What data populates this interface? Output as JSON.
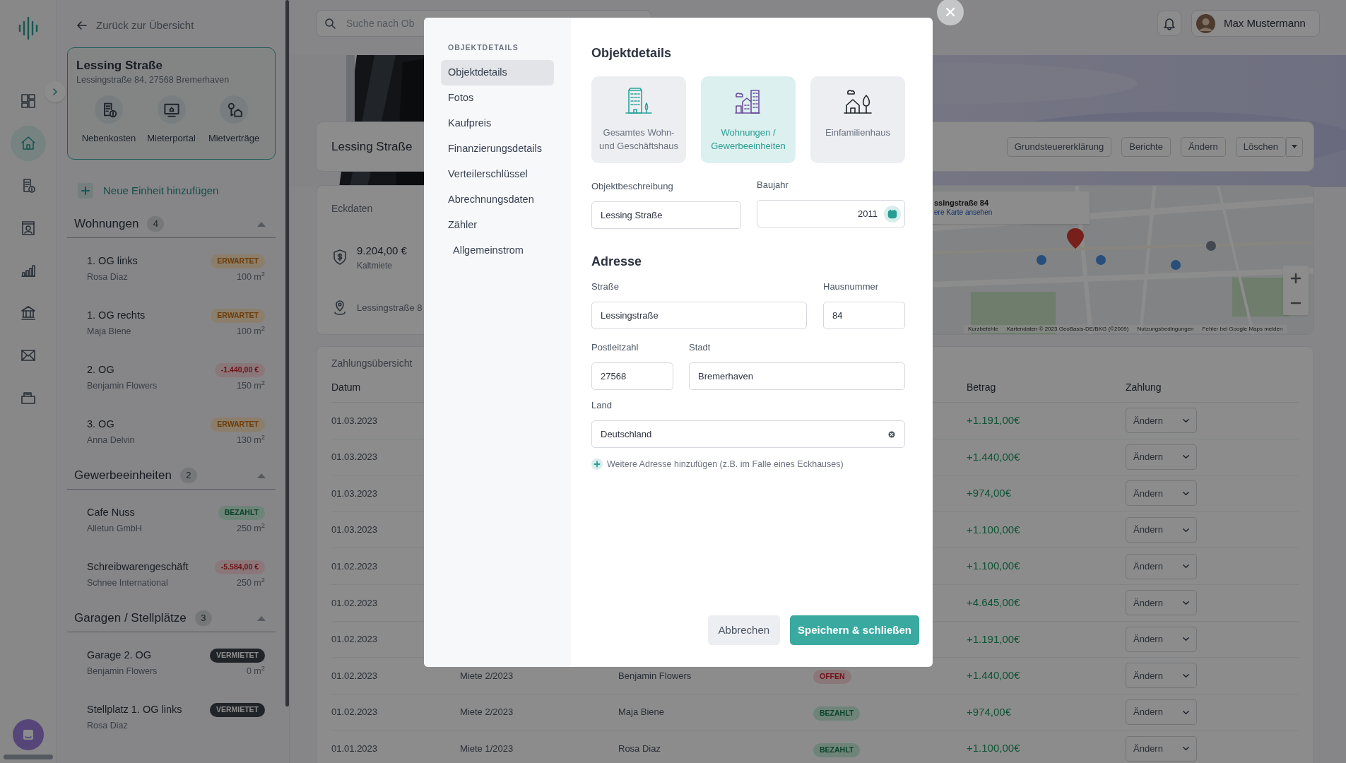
{
  "icon_rail": {
    "items": [
      {
        "kind": "dashboard",
        "selected": false
      },
      {
        "kind": "home",
        "selected": true
      },
      {
        "kind": "billing",
        "selected": false
      },
      {
        "kind": "contacts",
        "selected": false
      },
      {
        "kind": "chart",
        "selected": false
      },
      {
        "kind": "bank",
        "selected": false
      },
      {
        "kind": "mail",
        "selected": false
      },
      {
        "kind": "archive",
        "selected": false
      }
    ]
  },
  "sidebar": {
    "back_link": "Zurück zur Übersicht",
    "property": {
      "title": "Lessing Straße",
      "address": "Lessingstraße 84, 27568 Bremerhaven",
      "actions": [
        {
          "kind": "costs",
          "label": "Nebenkosten"
        },
        {
          "kind": "portal",
          "label": "Mieterportal"
        },
        {
          "kind": "contracts",
          "label": "Mietverträge"
        }
      ]
    },
    "add_unit": "Neue Einheit hinzufügen",
    "groups": [
      {
        "title": "Wohnungen",
        "count": "4",
        "expanded": true,
        "units": [
          {
            "name": "1. OG links",
            "tenant": "Rosa Diaz",
            "area": "100 m$^{2}$",
            "badge": {
              "text": "ERWARTET",
              "kind": "expected"
            }
          },
          {
            "name": "1. OG rechts",
            "tenant": "Maja Biene",
            "area": "100 m$^{2}$",
            "badge": {
              "text": "ERWARTET",
              "kind": "expected"
            }
          },
          {
            "name": "2. OG",
            "tenant": "Benjamin Flowers",
            "area": "150 m$^{2}$",
            "badge": {
              "text": "-1.440,00 €",
              "kind": "overdue"
            }
          },
          {
            "name": "3. OG",
            "tenant": "Anna Delvin",
            "area": "130 m$^{2}$",
            "badge": {
              "text": "ERWARTET",
              "kind": "expected"
            }
          }
        ]
      },
      {
        "title": "Gewerbeeinheiten",
        "count": "2",
        "expanded": true,
        "units": [
          {
            "name": "Cafe Nuss",
            "tenant": "Alletun GmbH",
            "area": "250 m$^{2}$",
            "badge": {
              "text": "BEZAHLT",
              "kind": "paid"
            }
          },
          {
            "name": "Schreibwarengeschäft",
            "tenant": "Schnee International",
            "area": "250 m$^{2}$",
            "badge": {
              "text": "-5.584,00 €",
              "kind": "overdue"
            }
          }
        ]
      },
      {
        "title": "Garagen / Stellplätze",
        "count": "3",
        "expanded": true,
        "units": [
          {
            "name": "Garage 2. OG",
            "tenant": "Benjamin Flowers",
            "area": "0 m$^{2}$",
            "badge": {
              "text": "VERMIETET",
              "kind": "rented"
            }
          },
          {
            "name": "Stellplatz 1. OG links",
            "tenant": "Rosa Diaz",
            "badge": {
              "text": "VERMIETET",
              "kind": "rented"
            }
          }
        ]
      }
    ]
  },
  "topbar": {
    "search": {
      "placeholder": "Suche nach Ob"
    },
    "user": "Max Mustermann"
  },
  "property_header": {
    "title": "Lessing Straße",
    "buttons": [
      "Grundsteuererklärung",
      "Berichte",
      "Ändern",
      "Löschen"
    ]
  },
  "key_data": {
    "title": "Eckdaten",
    "rent": {
      "value": "9.204,00 €",
      "label": "Kaltmiete"
    },
    "address": "Lessingstraße 8",
    "map": {
      "popup": {
        "title": "ssingstraße 84",
        "link": "ere Karte ansehen"
      },
      "footer": [
        "Kurzbefehle",
        "Kartendaten © 2023 GeoBasis-DE/BKG (©2009)",
        "Nutzungsbedingungen",
        "Fehler bei Google Maps melden"
      ]
    }
  },
  "payments": {
    "title": "Zahlungsübersicht",
    "columns": {
      "date": "Datum",
      "amount": "Betrag",
      "payment": "Zahlung"
    },
    "rows": [
      {
        "date": "01.03.2023",
        "amount": "+1.191,00€",
        "payment": "Ändern"
      },
      {
        "date": "01.03.2023",
        "amount": "+1.440,00€",
        "payment": "Ändern"
      },
      {
        "date": "01.03.2023",
        "amount": "+974,00€",
        "payment": "Ändern"
      },
      {
        "date": "01.03.2023",
        "amount": "+1.100,00€",
        "payment": "Ändern"
      },
      {
        "date": "01.02.2023",
        "amount": "+1.100,00€",
        "payment": "Ändern"
      },
      {
        "date": "01.02.2023",
        "amount": "+4.645,00€",
        "payment": "Ändern"
      },
      {
        "date": "01.02.2023",
        "amount": "+1.191,00€",
        "payment": "Ändern"
      },
      {
        "date": "01.02.2023",
        "purpose": "Miete 2/2023",
        "tenant": "Benjamin Flowers",
        "status": {
          "text": "OFFEN",
          "kind": "open"
        },
        "amount": "+1.440,00€",
        "payment": "Ändern"
      },
      {
        "date": "01.02.2023",
        "purpose": "Miete 2/2023",
        "tenant": "Maja Biene",
        "status": {
          "text": "BEZAHLT",
          "kind": "paid"
        },
        "amount": "+974,00€",
        "payment": "Ändern"
      },
      {
        "date": "01.01.2023",
        "purpose": "Miete 1/2023",
        "tenant": "Rosa Diaz",
        "status": {
          "text": "BEZAHLT",
          "kind": "paid"
        },
        "amount": "+1.100,00€",
        "payment": "Ändern"
      }
    ]
  },
  "modal": {
    "nav_heading": "OBJEKTDETAILS",
    "nav": [
      {
        "label": "Objektdetails",
        "selected": true
      },
      {
        "label": "Fotos",
        "selected": false
      },
      {
        "label": "Kaufpreis",
        "selected": false
      },
      {
        "label": "Finanzierungsdetails",
        "selected": false
      },
      {
        "label": "Verteilerschlüssel",
        "selected": false
      },
      {
        "label": "Abrechnungsdaten",
        "selected": false
      },
      {
        "label": "Zähler",
        "selected": false,
        "children": [
          {
            "label": "Allgemeinstrom",
            "selected": false
          }
        ]
      }
    ],
    "title": "Objektdetails",
    "types": [
      {
        "kind": "building",
        "label": "Gesamtes Wohn- und Geschäftshaus",
        "selected": false
      },
      {
        "kind": "city",
        "label": "Wohnungen / Gewerbeeinheiten",
        "selected": true
      },
      {
        "kind": "house",
        "label": "Einfamilienhaus",
        "selected": false
      }
    ],
    "description": {
      "label": "Objektbeschreibung",
      "value": "Lessing Straße"
    },
    "year": {
      "label": "Baujahr",
      "value": "2011"
    },
    "address_title": "Adresse",
    "street": {
      "label": "Straße",
      "value": "Lessingstraße"
    },
    "house_number": {
      "label": "Hausnummer",
      "value": "84"
    },
    "postal_code": {
      "label": "Postleitzahl",
      "value": "27568"
    },
    "city": {
      "label": "Stadt",
      "value": "Bremerhaven"
    },
    "country": {
      "label": "Land",
      "value": "Deutschland"
    },
    "add_address": "Weitere Adresse hinzufügen (z.B. im Falle eines Eckhauses)",
    "cancel": "Abbrechen",
    "save": "Speichern & schließen"
  }
}
